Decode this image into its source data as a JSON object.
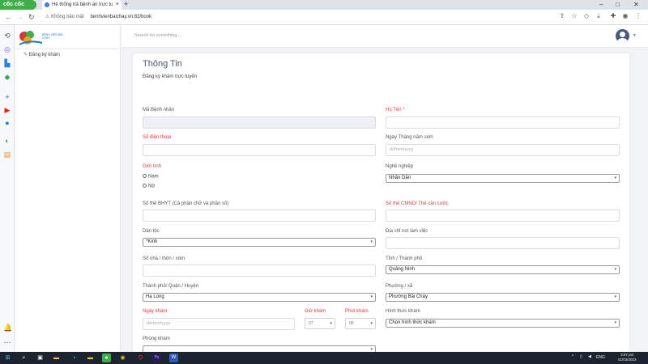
{
  "browser": {
    "brand": "cốc cốc",
    "tab_title": "Hệ thống trả bệnh án trực tu",
    "new_tab": "+",
    "security_label": "Không bảo mật",
    "url": "benhvienbaichay.vn:82/book",
    "win_minimize": "–",
    "win_maximize": "□",
    "win_close": "✕"
  },
  "hospital_logo_text": "BỆNH VIỆN BÃI CHÁY",
  "sidebar": {
    "items": [
      {
        "label": "Đăng ký khám",
        "icon": "pencil-icon"
      }
    ]
  },
  "header": {
    "search_placeholder": "Search for something..."
  },
  "form": {
    "title": "Thông Tin",
    "subtitle": "Đăng ký khám trực tuyến",
    "ma_benh_nhan_label": "Mã Bệnh nhân",
    "ho_ten_label": "Họ Tên *",
    "so_dien_thoai_label": "Số điện thoại",
    "ngay_sinh_label": "Ngày Tháng năm sinh",
    "ngay_sinh_placeholder": "dd/mm/yyyy",
    "gioi_tinh_label": "Giới tính",
    "gioi_tinh_options": [
      "Nam",
      "Nữ"
    ],
    "nghe_nghiep_label": "Nghề nghiệp",
    "nghe_nghiep_value": "Nhân Dân",
    "bhyt_label": "Số thẻ BHYT (Cả phần chữ và phần số)",
    "cmnd_label": "Số thẻ CMND/ Thẻ căn cước",
    "dan_toc_label": "Dân tộc",
    "dan_toc_value": "*Kinh",
    "noi_lam_viec_label": "Địa chỉ nơi làm việc",
    "so_nha_label": "Số nhà / thôn / xóm",
    "tinh_label": "Tỉnh / Thành phố",
    "tinh_value": "Quảng Ninh",
    "quan_label": "Thành phố/ Quận / Huyện",
    "quan_value": "Hạ Long",
    "phuong_label": "Phường / xã",
    "phuong_value": "Phường Bãi Cháy",
    "ngay_kham_label": "Ngày khám",
    "ngay_kham_placeholder": "dd/mm/yyyy",
    "gio_kham_label": "Giờ khám",
    "gio_kham_value": "07",
    "phut_kham_label": "Phút khám",
    "phut_kham_value": "00",
    "hinh_thuc_label": "Hình thức khám",
    "hinh_thuc_value": "Chọn hình thức khám",
    "phong_kham_label": "Phòng khám"
  },
  "colors": {
    "required_label": "#e53935",
    "brand_green": "#3fae49"
  },
  "taskbar": {
    "language": "ENG",
    "time": "3:07 pm",
    "date": "01/03/2023"
  }
}
